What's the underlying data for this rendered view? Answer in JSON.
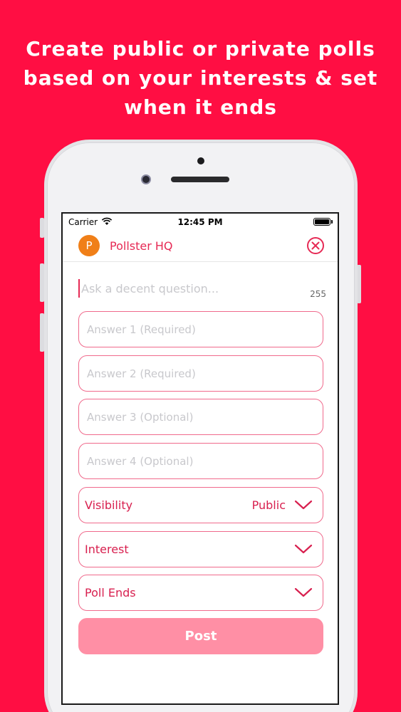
{
  "promo": {
    "line1": "Create public or private polls",
    "line2": "based on your interests & set",
    "line3": "when it ends"
  },
  "status_bar": {
    "carrier": "Carrier",
    "time": "12:45 PM"
  },
  "nav": {
    "avatar_letter": "P",
    "title": "Pollster HQ",
    "close_icon": "close-circle-icon"
  },
  "question": {
    "placeholder": "Ask a decent question...",
    "value": "",
    "char_count": "255"
  },
  "answers": [
    {
      "placeholder": "Answer 1 (Required)",
      "value": ""
    },
    {
      "placeholder": "Answer 2 (Required)",
      "value": ""
    },
    {
      "placeholder": "Answer 3 (Optional)",
      "value": ""
    },
    {
      "placeholder": "Answer 4 (Optional)",
      "value": ""
    }
  ],
  "selects": {
    "visibility": {
      "label": "Visibility",
      "value": "Public"
    },
    "interest": {
      "label": "Interest",
      "value": ""
    },
    "poll_ends": {
      "label": "Poll Ends",
      "value": ""
    }
  },
  "post_button": {
    "label": "Post"
  },
  "colors": {
    "background": "#ff0e43",
    "accent": "#e62a55",
    "avatar": "#f07f18",
    "post_disabled": "#ff8fa5"
  }
}
